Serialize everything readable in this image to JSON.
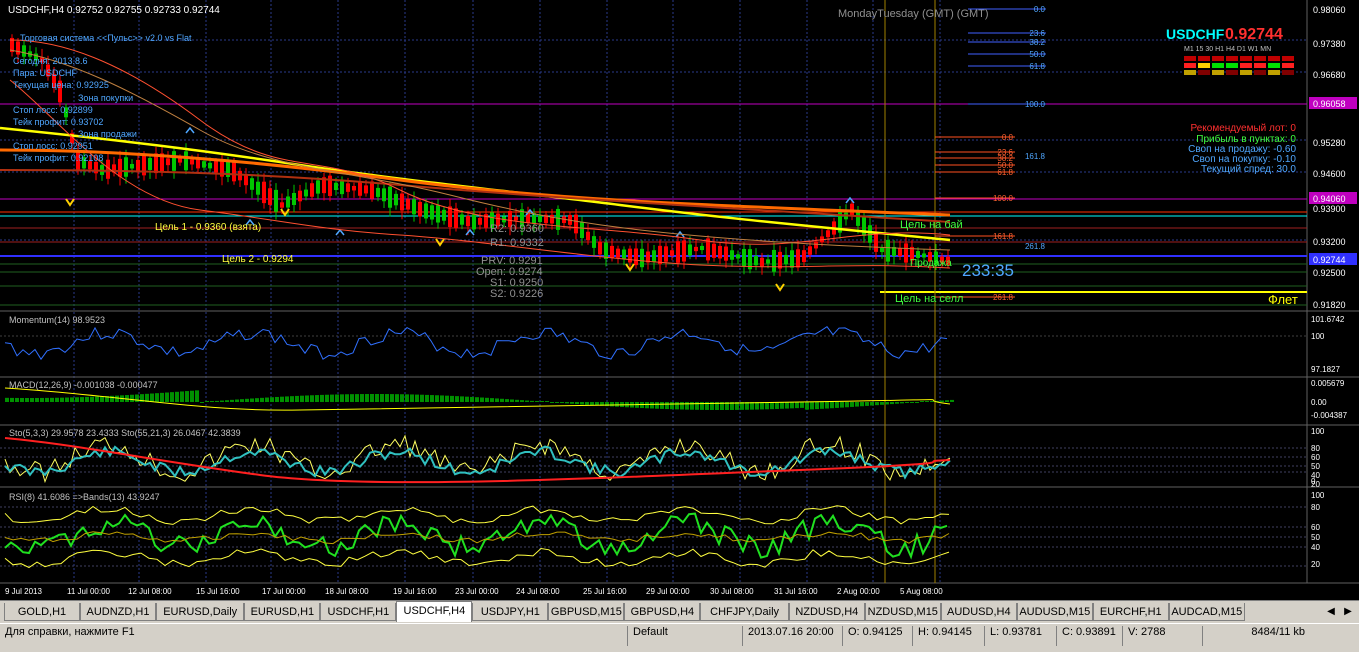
{
  "chart": {
    "header": "USDCHF,H4  0.92752 0.92755 0.92733 0.92744",
    "symbol": "USDCHF",
    "price": "0.92744",
    "timeframes": "M1  15  30  H1  H4  D1  W1  MN",
    "server_time_label": "MondayTuesday   (GMT)   (GMT)"
  },
  "info_panel": {
    "title": "Торговая система <<Пульс>> v2.0 vs Flat",
    "date": "Сегодня: 2013.8.6",
    "pair": "Пара: USDCHF",
    "current_price": "Текущая цена: 0.92925",
    "buy_zone": "Зона покупки",
    "stop_loss_1": "Стоп лосс: 0.92899",
    "take_profit_1": "Тейк профит: 0.93702",
    "sell_zone": "Зона продажи",
    "stop_loss_2": "Стоп лосс: 0.92951",
    "take_profit_2": "Тейк профит: 0.92108"
  },
  "targets": {
    "target1": "Цель 1 - 0.9360 (взята)",
    "target2": "Цель 2 - 0.9294",
    "buy_target": "Цель на бай",
    "sell_target": "Цель на селл",
    "flat": "Флет",
    "flat_label": "Продажа",
    "countdown": "233:35"
  },
  "right_panel": {
    "lot": "Рекомендуемый лот: 0",
    "profit": "Прибыль в пунктах: 0",
    "swap_sell": "Своп на продажу: -0.60",
    "swap_buy": "Своп на покупку: -0.10",
    "spread": "Текущий спред: 30.0"
  },
  "pivots": {
    "r2": "R2: 0.9360",
    "r1": "R1: 0.9332",
    "prv": "PRV: 0.9291",
    "open": "Open: 0.9274",
    "s1": "S1: 0.9250",
    "s2": "S2: 0.9226"
  },
  "fib_upper": [
    "0.0",
    "23.6",
    "38.2",
    "50.0",
    "61.8",
    "100.0"
  ],
  "fib_lower": [
    "0.0",
    "23.6",
    "38.2",
    "50.0",
    "61.8",
    "100.0",
    "161.8",
    "261.8"
  ],
  "fib_mid": [
    "161.8",
    "261.8"
  ],
  "price_axis": [
    "0.98060",
    "0.97380",
    "0.96680",
    "0.96058",
    "0.95280",
    "0.94600",
    "0.94060",
    "0.93900",
    "0.93200",
    "0.92744",
    "0.92500",
    "0.91820"
  ],
  "price_axis_highlight": {
    "magenta": "0.96058",
    "magenta2": "0.94060",
    "blue": "0.92744"
  },
  "time_axis": [
    "9 Jul 2013",
    "11 Jul 00:00",
    "12 Jul 08:00",
    "15 Jul 16:00",
    "17 Jul 00:00",
    "18 Jul 08:00",
    "19 Jul 16:00",
    "23 Jul 00:00",
    "24 Jul 08:00",
    "25 Jul 16:00",
    "29 Jul 00:00",
    "30 Jul 08:00",
    "31 Jul 16:00",
    "2 Aug 00:00",
    "5 Aug 08:00"
  ],
  "indicators": {
    "momentum": {
      "label": "Momentum(14) 98.9523",
      "scale": [
        "101.6742",
        "100",
        "97.1827"
      ]
    },
    "macd": {
      "label": "MACD(12,26,9) -0.001038 -0.000477",
      "scale": [
        "0.005679",
        "0.00",
        "-0.004387"
      ]
    },
    "sto": {
      "label": "Sto(5,3,3) 29.9578 23.4333  Sto(55,21,3) 26.0467 42.3839",
      "scale": [
        "100",
        "80",
        "60",
        "50",
        "40",
        "20",
        "0"
      ]
    },
    "rsi": {
      "label": "RSI(8) 41.6086  =>Bands(13) 43.9247",
      "scale": [
        "100",
        "80",
        "60",
        "50",
        "40",
        "20"
      ]
    }
  },
  "tabs": [
    "GOLD,H1",
    "AUDNZD,H1",
    "EURUSD,Daily",
    "EURUSD,H1",
    "USDCHF,H1",
    "USDCHF,H4",
    "USDJPY,H1",
    "GBPUSD,M15",
    "GBPUSD,H4",
    "CHFJPY,Daily",
    "NZDUSD,H4",
    "NZDUSD,M15",
    "AUDUSD,H4",
    "AUDUSD,M15",
    "EURCHF,H1",
    "AUDCAD,M15"
  ],
  "active_tab": "USDCHF,H4",
  "status": {
    "help": "Для справки, нажмите F1",
    "profile": "Default",
    "datetime": "2013.07.16 20:00",
    "open": "O: 0.94125",
    "high": "H: 0.94145",
    "low": "L: 0.93781",
    "close": "C: 0.93891",
    "volume": "V: 2788",
    "traffic": "8484/11 kb"
  },
  "colors": {
    "bull": "#00c800",
    "bear": "#ff0000",
    "grid": "#2a3a8a",
    "ema_yellow": "#ffff00",
    "ema_orange": "#ff6a00",
    "magenta": "#c040c0",
    "accent_cyan": "#00ffff"
  }
}
